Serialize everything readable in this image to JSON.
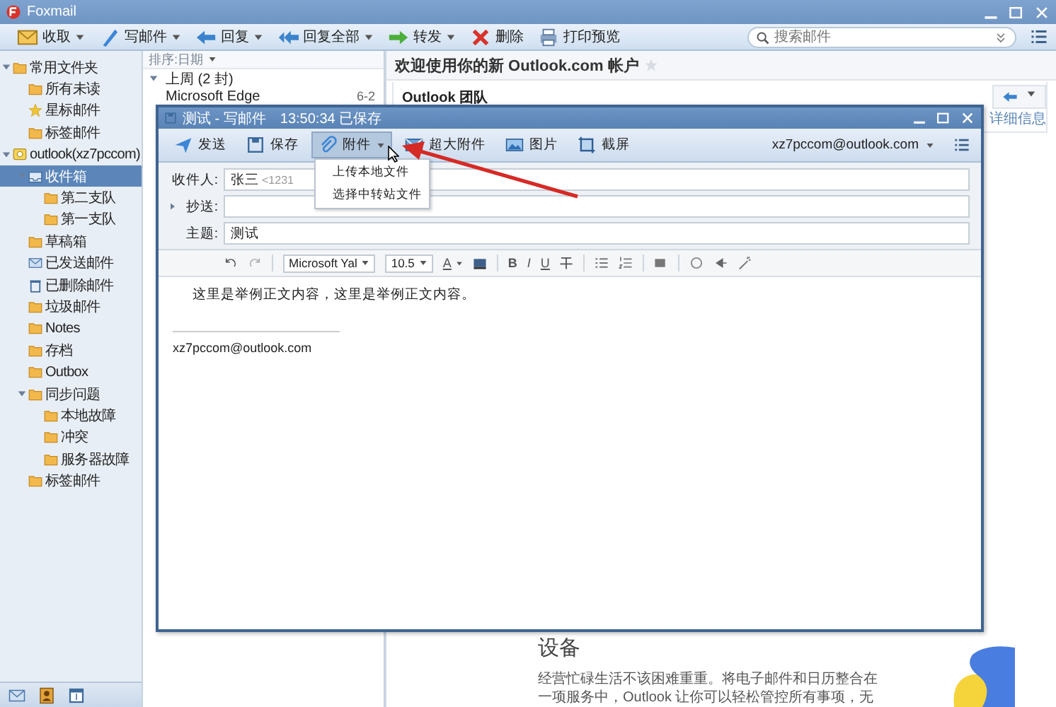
{
  "app": {
    "title": "Foxmail"
  },
  "toolbar": [
    {
      "label": "收取",
      "dropdown": true
    },
    {
      "label": "写邮件",
      "dropdown": true
    },
    {
      "label": "回复",
      "dropdown": true
    },
    {
      "label": "回复全部",
      "dropdown": true
    },
    {
      "label": "转发",
      "dropdown": true
    },
    {
      "label": "删除",
      "dropdown": false
    },
    {
      "label": "打印预览",
      "dropdown": false
    }
  ],
  "search": {
    "placeholder": "搜索邮件"
  },
  "sidebar": {
    "items": [
      {
        "label": "常用文件夹",
        "expanded": true,
        "selected": false,
        "children": [
          {
            "label": "所有未读",
            "selected": false
          },
          {
            "label": "星标邮件",
            "selected": false
          },
          {
            "label": "标签邮件",
            "selected": false
          }
        ]
      },
      {
        "label": "outlook(xz7pccom)",
        "expanded": true,
        "selected": false,
        "children": [
          {
            "label": "收件箱",
            "expanded": true,
            "selected": true,
            "children": [
              {
                "label": "第二支队",
                "selected": false
              },
              {
                "label": "第一支队",
                "selected": false
              }
            ]
          },
          {
            "label": "草稿箱",
            "selected": false
          },
          {
            "label": "已发送邮件",
            "selected": false
          },
          {
            "label": "已删除邮件",
            "selected": false
          },
          {
            "label": "垃圾邮件",
            "selected": false
          },
          {
            "label": "Notes",
            "selected": false
          },
          {
            "label": "存档",
            "selected": false
          },
          {
            "label": "Outbox",
            "selected": false
          },
          {
            "label": "同步问题",
            "expanded": true,
            "selected": false,
            "children": [
              {
                "label": "本地故障",
                "selected": false
              },
              {
                "label": "冲突",
                "selected": false
              },
              {
                "label": "服务器故障",
                "selected": false
              }
            ]
          },
          {
            "label": "标签邮件",
            "selected": false
          }
        ]
      }
    ]
  },
  "message_list": {
    "sort": "排序:日期",
    "groups": [
      {
        "label": "上周 (2 封)",
        "expanded": true,
        "messages": [
          {
            "sender": "Microsoft Edge",
            "date": "6-2"
          }
        ]
      }
    ]
  },
  "reading_pane": {
    "subject": "欢迎使用你的新 Outlook.com 帐户",
    "sender": "Outlook 团队",
    "details_link": "详细信息",
    "heading": "设备",
    "paragraph": [
      "经营忙碌生活不该困难重重。将电子邮件和日历整合在",
      "一项服务中，Outlook 让你可以轻松管控所有事项，无"
    ]
  },
  "compose": {
    "title": "测试 - 写邮件",
    "saved": "13:50:34 已保存",
    "toolbar": [
      {
        "label": "发送",
        "pressed": false,
        "dropdown": false
      },
      {
        "label": "保存",
        "pressed": false,
        "dropdown": false
      },
      {
        "label": "附件",
        "pressed": true,
        "dropdown": true
      },
      {
        "label": "超大附件",
        "pressed": false,
        "dropdown": false
      },
      {
        "label": "图片",
        "pressed": false,
        "dropdown": false
      },
      {
        "label": "截屏",
        "pressed": false,
        "dropdown": false
      }
    ],
    "account": "xz7pccom@outlook.com",
    "menu": [
      "上传本地文件",
      "选择中转站文件"
    ],
    "fields": [
      {
        "label": "收件人:",
        "value": "张三",
        "hint": "<1231"
      },
      {
        "label": "抄送:",
        "expandable": true
      },
      {
        "label": "主题:",
        "value": "测试"
      }
    ],
    "format": {
      "font": "Microsoft Yal",
      "size": "10.5",
      "color_button": "A",
      "styles": [
        "B",
        "I",
        "U"
      ]
    },
    "body": "这里是举例正文内容，这里是举例正文内容。",
    "signature": "xz7pccom@outlook.com"
  }
}
